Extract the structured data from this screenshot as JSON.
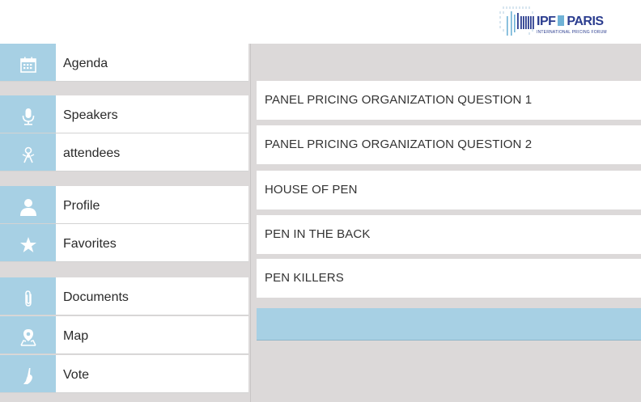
{
  "header": {
    "logo": {
      "brand_left": "IPF",
      "brand_right": "PARIS",
      "tagline": "INTERNATIONAL PRICING FORUM"
    }
  },
  "sidebar": {
    "items": [
      {
        "label": "Agenda",
        "icon": "calendar-icon"
      },
      {
        "label": "Speakers",
        "icon": "microphone-icon"
      },
      {
        "label": "attendees",
        "icon": "attendees-icon"
      },
      {
        "label": "Profile",
        "icon": "person-icon"
      },
      {
        "label": "Favorites",
        "icon": "star-icon"
      },
      {
        "label": "Documents",
        "icon": "paperclip-icon"
      },
      {
        "label": "Map",
        "icon": "map-pin-icon"
      },
      {
        "label": "Vote",
        "icon": "hand-icon"
      }
    ]
  },
  "content": {
    "rows": [
      {
        "label": "PANEL PRICING ORGANIZATION QUESTION 1"
      },
      {
        "label": "PANEL PRICING ORGANIZATION QUESTION 2"
      },
      {
        "label": "HOUSE OF PEN"
      },
      {
        "label": "PEN IN THE BACK"
      },
      {
        "label": "PEN KILLERS"
      },
      {
        "label": ""
      }
    ]
  },
  "colors": {
    "accent": "#a7d0e4",
    "background": "#dcd9d9",
    "brand": "#2b3d8f"
  }
}
